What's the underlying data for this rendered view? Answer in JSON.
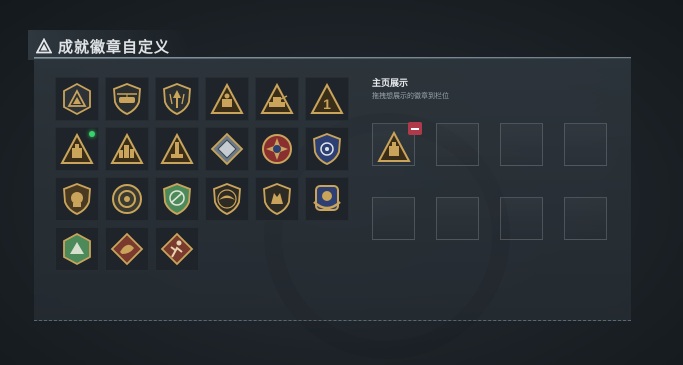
{
  "header": {
    "title": "成就徽章自定义",
    "icon": "warning-triangle-icon"
  },
  "showcase": {
    "title": "主页展示",
    "subtitle": "拖拽想展示的徽章到栏位"
  },
  "badges": [
    {
      "icon": "triangle-emblem-icon",
      "new": false
    },
    {
      "icon": "helicopter-shield-icon",
      "new": false
    },
    {
      "icon": "arrow-shield-icon",
      "new": false
    },
    {
      "icon": "gold-triangle-icon",
      "new": false
    },
    {
      "icon": "tank-triangle-icon",
      "new": false
    },
    {
      "icon": "rank-one-triangle-icon",
      "new": false
    },
    {
      "icon": "box-triangle-icon",
      "new": true
    },
    {
      "icon": "city-triangle-icon",
      "new": false
    },
    {
      "icon": "tower-triangle-icon",
      "new": false
    },
    {
      "icon": "diamond-badge-icon",
      "new": false
    },
    {
      "icon": "cross-medal-icon",
      "new": false
    },
    {
      "icon": "police-shield-icon",
      "new": false
    },
    {
      "icon": "lion-badge-icon",
      "new": false
    },
    {
      "icon": "wreath-badge-icon",
      "new": false
    },
    {
      "icon": "green-shield-icon",
      "new": false
    },
    {
      "icon": "bird-shield-icon",
      "new": false
    },
    {
      "icon": "wolf-shield-icon",
      "new": false
    },
    {
      "icon": "eagle-crest-icon",
      "new": false
    },
    {
      "icon": "green-hex-icon",
      "new": false
    },
    {
      "icon": "dragon-diamond-icon",
      "new": false
    },
    {
      "icon": "runner-diamond-icon",
      "new": false
    }
  ],
  "slots": [
    {
      "filled": true,
      "icon": "box-triangle-icon"
    },
    {
      "filled": false
    },
    {
      "filled": false
    },
    {
      "filled": false
    },
    {
      "filled": false
    },
    {
      "filled": false
    },
    {
      "filled": false
    },
    {
      "filled": false
    }
  ],
  "colors": {
    "gold": "#c9a45a",
    "dark": "#3a2e18",
    "accent_red": "#b03a4a",
    "new_dot": "#38d36a",
    "green": "#4c8a5a",
    "navy": "#2d3f73"
  }
}
